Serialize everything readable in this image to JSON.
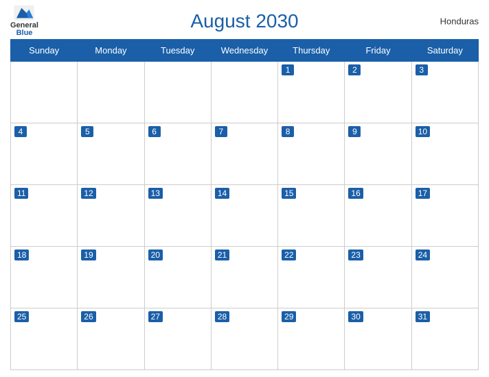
{
  "header": {
    "title": "August 2030",
    "country": "Honduras",
    "logo": {
      "general": "General",
      "blue": "Blue"
    }
  },
  "weekdays": [
    "Sunday",
    "Monday",
    "Tuesday",
    "Wednesday",
    "Thursday",
    "Friday",
    "Saturday"
  ],
  "weeks": [
    [
      null,
      null,
      null,
      null,
      1,
      2,
      3
    ],
    [
      4,
      5,
      6,
      7,
      8,
      9,
      10
    ],
    [
      11,
      12,
      13,
      14,
      15,
      16,
      17
    ],
    [
      18,
      19,
      20,
      21,
      22,
      23,
      24
    ],
    [
      25,
      26,
      27,
      28,
      29,
      30,
      31
    ]
  ]
}
